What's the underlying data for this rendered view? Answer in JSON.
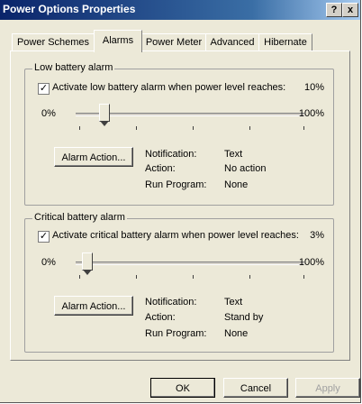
{
  "window": {
    "title": "Power Options Properties",
    "help_label": "?",
    "close_label": "x"
  },
  "tabs": [
    {
      "label": "Power Schemes"
    },
    {
      "label": "Alarms",
      "active": true
    },
    {
      "label": "Power Meter"
    },
    {
      "label": "Advanced"
    },
    {
      "label": "Hibernate"
    }
  ],
  "low_battery": {
    "group_title": "Low battery alarm",
    "checkbox_label": "Activate low battery alarm when power level reaches:",
    "checked": true,
    "checkmark": "✓",
    "level_text": "10%",
    "level_value": 10,
    "slider_min": "0%",
    "slider_max": "100%",
    "alarm_button": "Alarm Action...",
    "notification_label": "Notification:",
    "notification_value": "Text",
    "action_label": "Action:",
    "action_value": "No action",
    "run_program_label": "Run Program:",
    "run_program_value": "None"
  },
  "critical_battery": {
    "group_title": "Critical battery alarm",
    "checkbox_label": "Activate critical battery alarm when power level reaches:",
    "checked": true,
    "checkmark": "✓",
    "level_text": "3%",
    "level_value": 3,
    "slider_min": "0%",
    "slider_max": "100%",
    "alarm_button": "Alarm Action...",
    "notification_label": "Notification:",
    "notification_value": "Text",
    "action_label": "Action:",
    "action_value": "Stand by",
    "run_program_label": "Run Program:",
    "run_program_value": "None"
  },
  "footer": {
    "ok_label": "OK",
    "cancel_label": "Cancel",
    "apply_label": "Apply"
  }
}
